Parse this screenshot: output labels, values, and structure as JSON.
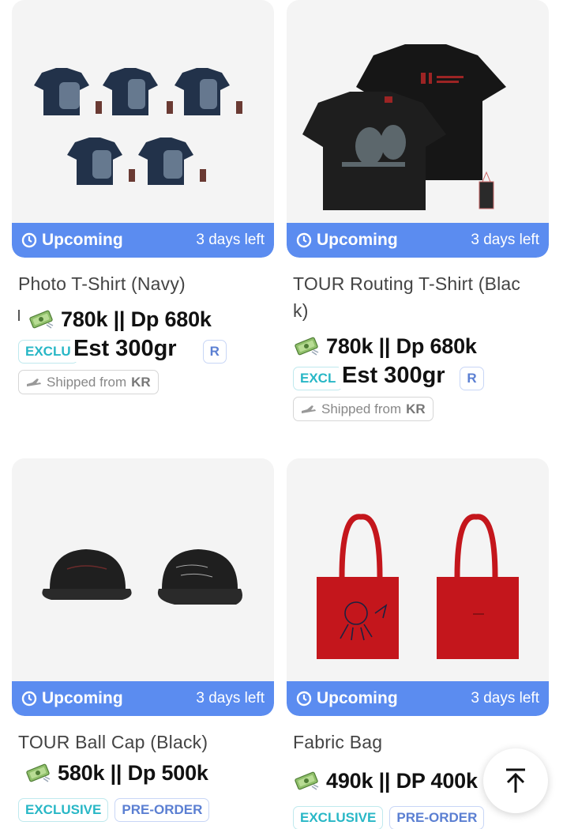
{
  "products": [
    {
      "title": "Photo T-Shirt (Navy)",
      "status": "Upcoming",
      "time_left": "3 days left",
      "price": "780k || Dp 680k",
      "tags": [
        "EXCLU",
        "R"
      ],
      "est": "Est 300gr",
      "shipped_prefix": "Shipped from",
      "shipped_country": "KR",
      "image_icon": "navy-photo-tshirts-image"
    },
    {
      "title": "TOUR Routing T-Shirt (Black)",
      "title_line1": "TOUR Routing T-Shirt (Blac",
      "title_line2": "k)",
      "status": "Upcoming",
      "time_left": "3 days left",
      "price": "780k || Dp 680k",
      "tags": [
        "EXCL",
        "R"
      ],
      "est": "Est 300gr",
      "shipped_prefix": "Shipped from",
      "shipped_country": "KR",
      "image_icon": "black-tour-tshirt-image"
    },
    {
      "title": "TOUR Ball Cap (Black)",
      "status": "Upcoming",
      "time_left": "3 days left",
      "price": "580k || Dp 500k",
      "tags": [
        "EXCLUSIVE",
        "PRE-ORDER"
      ],
      "image_icon": "black-ball-cap-image"
    },
    {
      "title": "Fabric Bag",
      "status": "Upcoming",
      "time_left": "3 days left",
      "price": "490k || DP 400k",
      "tags": [
        "EXCLUSIVE",
        "PRE-ORDER"
      ],
      "image_icon": "red-fabric-bag-image"
    }
  ],
  "colors": {
    "status_bar": "#5b8cf0",
    "exclusive_tag": "#28b7c6",
    "preorder_tag": "#5b7fd2"
  },
  "scroll_top_icon": "arrow-up-to-top-icon"
}
